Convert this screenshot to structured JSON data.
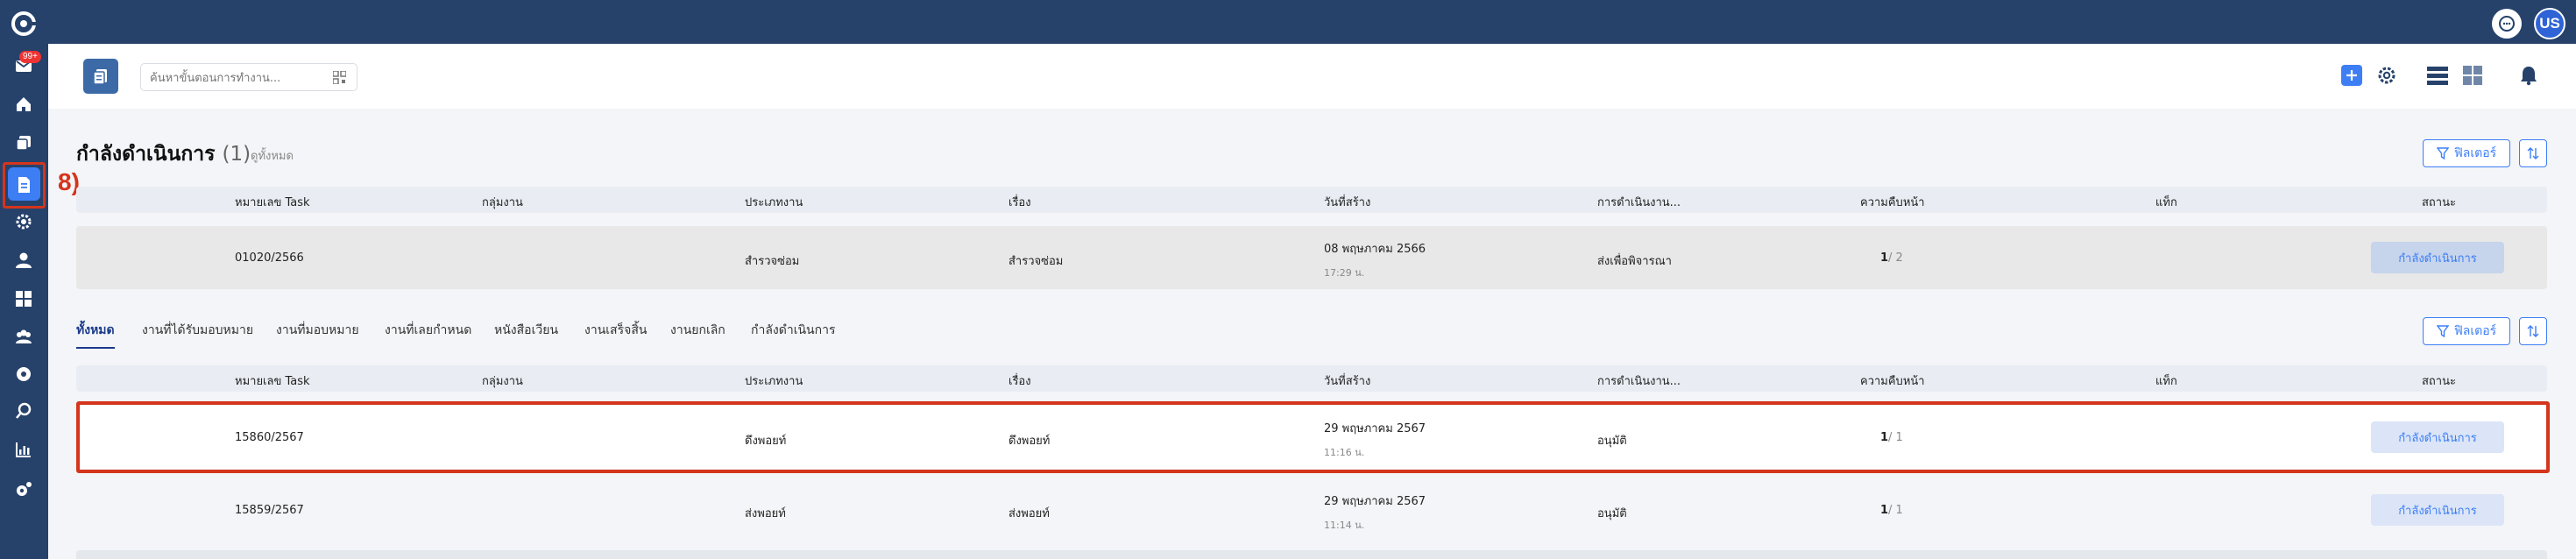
{
  "topbar": {
    "avatar_initials": "US",
    "chat_icon": "chat-bubble-icon"
  },
  "sidebar": {
    "badge": "99+",
    "step_label": "8)",
    "items": [
      "mail-icon",
      "home-icon",
      "copy-icon",
      "document-icon",
      "settings-icon",
      "user-icon",
      "grid-icon",
      "group-icon",
      "gear-icon",
      "search-icon",
      "chart-icon",
      "config-icon"
    ]
  },
  "header": {
    "search_placeholder": "ค้นหาขั้นตอนการทำงาน...",
    "icons": [
      "add-icon",
      "settings-icon",
      "list-view-icon",
      "grid-view-icon",
      "bell-icon"
    ]
  },
  "in_progress": {
    "title": "กำลังดำเนินการ",
    "count": "(1)",
    "see_all": "ดูทั้งหมด",
    "filter_label": "ฟิลเตอร์",
    "columns": [
      "หมายเลข Task",
      "กลุ่มงาน",
      "ประเภทงาน",
      "เรื่อง",
      "วันที่สร้าง",
      "การดำเนินงาน...",
      "ความคืบหน้า",
      "แท็ก",
      "สถานะ"
    ],
    "rows": [
      {
        "task_no": "01020/2566",
        "group": "",
        "type": "สำรวจซ่อม",
        "subject": "สำรวจซ่อม",
        "date": "08 พฤษภาคม 2566",
        "time": "17:29 น.",
        "operation": "ส่งเพื่อพิจารณา",
        "progress_done": "1",
        "progress_total": "/ 2",
        "tag": "",
        "status": "กำลังดำเนินการ"
      }
    ]
  },
  "all_tasks": {
    "tabs": [
      "ทั้งหมด",
      "งานที่ได้รับมอบหมาย",
      "งานที่มอบหมาย",
      "งานที่เลยกำหนด",
      "หนังสือเวียน",
      "งานเสร็จสิ้น",
      "งานยกเลิก",
      "กำลังดำเนินการ"
    ],
    "filter_label": "ฟิลเตอร์",
    "columns": [
      "หมายเลข Task",
      "กลุ่มงาน",
      "ประเภทงาน",
      "เรื่อง",
      "วันที่สร้าง",
      "การดำเนินงาน...",
      "ความคืบหน้า",
      "แท็ก",
      "สถานะ"
    ],
    "rows": [
      {
        "task_no": "15860/2567",
        "group": "",
        "type": "ดึงพอยท์",
        "subject": "ดึงพอยท์",
        "date": "29 พฤษภาคม 2567",
        "time": "11:16 น.",
        "operation": "อนุมัติ",
        "progress_done": "1",
        "progress_total": "/ 1",
        "tag": "",
        "status": "กำลังดำเนินการ"
      },
      {
        "task_no": "15859/2567",
        "group": "",
        "type": "ส่งพอยท์",
        "subject": "ส่งพอยท์",
        "date": "29 พฤษภาคม 2567",
        "time": "11:14 น.",
        "operation": "อนุมัติ",
        "progress_done": "1",
        "progress_total": "/ 1",
        "tag": "",
        "status": "กำลังดำเนินการ"
      }
    ]
  }
}
